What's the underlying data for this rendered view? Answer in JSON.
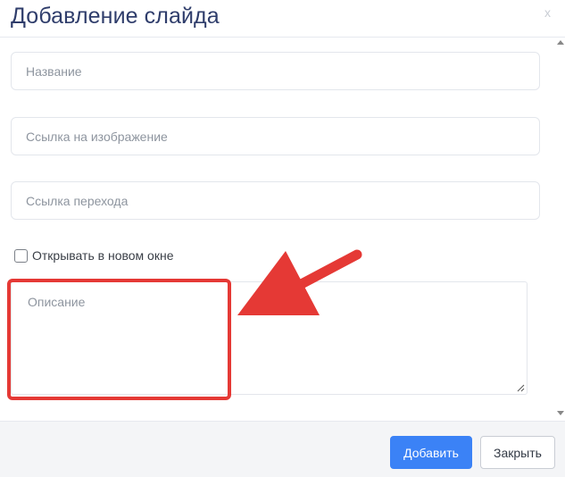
{
  "modal": {
    "title": "Добавление слайда",
    "close_label": "x"
  },
  "form": {
    "name_placeholder": "Название",
    "image_link_placeholder": "Ссылка на изображение",
    "target_link_placeholder": "Ссылка перехода",
    "new_window": {
      "label": "Открывать в новом окне",
      "checked": false
    },
    "description_placeholder": "Описание"
  },
  "footer": {
    "add_label": "Добавить",
    "close_label": "Закрыть"
  },
  "colors": {
    "title": "#2f3d6b",
    "primary": "#3b82f6",
    "annotation": "#e53935",
    "footer_bg": "#f4f5f7"
  }
}
